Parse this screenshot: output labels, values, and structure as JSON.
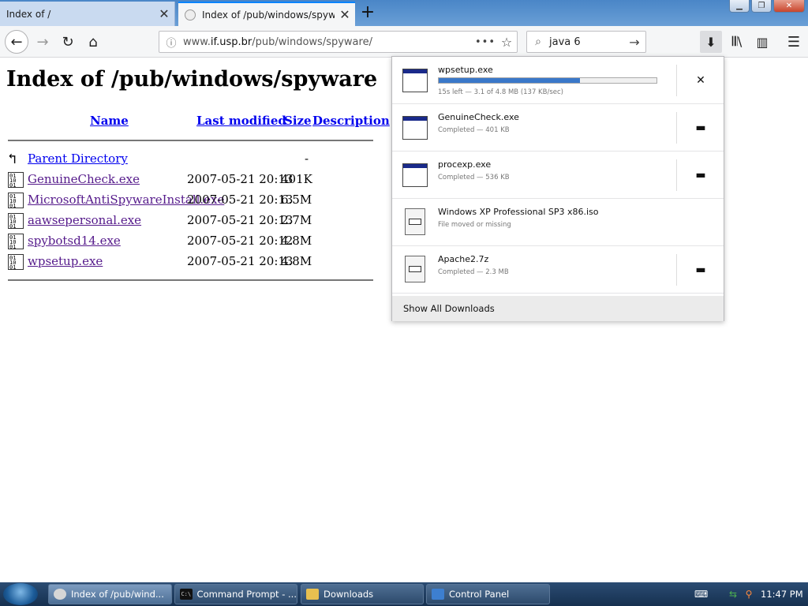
{
  "tabs": [
    {
      "title": "Index of /",
      "close": "✕"
    },
    {
      "title": "Index of /pub/windows/spyware",
      "close": "✕"
    }
  ],
  "new_tab": "+",
  "window_controls": {
    "minimize": "▁",
    "maximize": "❐",
    "close": "✕"
  },
  "nav": {
    "back": "←",
    "forward": "→",
    "reload": "↻",
    "home": "⌂"
  },
  "urlbar": {
    "info": "ⓘ",
    "prefix": "www.",
    "host": "if.usp.br",
    "path": "/pub/windows/spyware/",
    "more": "•••",
    "star": "☆"
  },
  "search": {
    "value": "java 6",
    "go": "→",
    "icon": "⌕"
  },
  "toolbar": {
    "download": "⬇",
    "library": "𝄃𝄃\\",
    "sidebar": "▥",
    "menu": "☰"
  },
  "page": {
    "title": "Index of /pub/windows/spyware",
    "headers": {
      "name": "Name",
      "modified": "Last modified",
      "size": "Size",
      "description": "Description"
    },
    "parent": {
      "name": "Parent Directory",
      "size": "-"
    },
    "files": [
      {
        "name": "GenuineCheck.exe",
        "modified": "2007-05-21 20:13",
        "size": "401K"
      },
      {
        "name": "MicrosoftAntiSpywareInstall.exe",
        "modified": "2007-05-21 20:13",
        "size": "6.5M"
      },
      {
        "name": "aawsepersonal.exe",
        "modified": "2007-05-21 20:13",
        "size": "2.7M"
      },
      {
        "name": "spybotsd14.exe",
        "modified": "2007-05-21 20:12",
        "size": "4.8M"
      },
      {
        "name": "wpsetup.exe",
        "modified": "2007-05-21 20:13",
        "size": "4.8M"
      }
    ]
  },
  "downloads": {
    "items": [
      {
        "name": "wpsetup.exe",
        "status": "15s left — 3.1 of 4.8 MB (137 KB/sec)",
        "progress": 0.65,
        "action": "✕"
      },
      {
        "name": "GenuineCheck.exe",
        "status": "Completed — 401 KB",
        "action": "▬"
      },
      {
        "name": "procexp.exe",
        "status": "Completed — 536 KB",
        "action": "▬"
      },
      {
        "name": "Windows XP Professional SP3 x86.iso",
        "status": "File moved or missing"
      },
      {
        "name": "Apache2.7z",
        "status": "Completed — 2.3 MB",
        "action": "▬"
      }
    ],
    "show_all": "Show All Downloads"
  },
  "taskbar": {
    "items": [
      {
        "label": "Index of /pub/wind..."
      },
      {
        "label": "Command Prompt - ..."
      },
      {
        "label": "Downloads"
      },
      {
        "label": "Control Panel"
      }
    ],
    "clock": "11:47 PM"
  }
}
